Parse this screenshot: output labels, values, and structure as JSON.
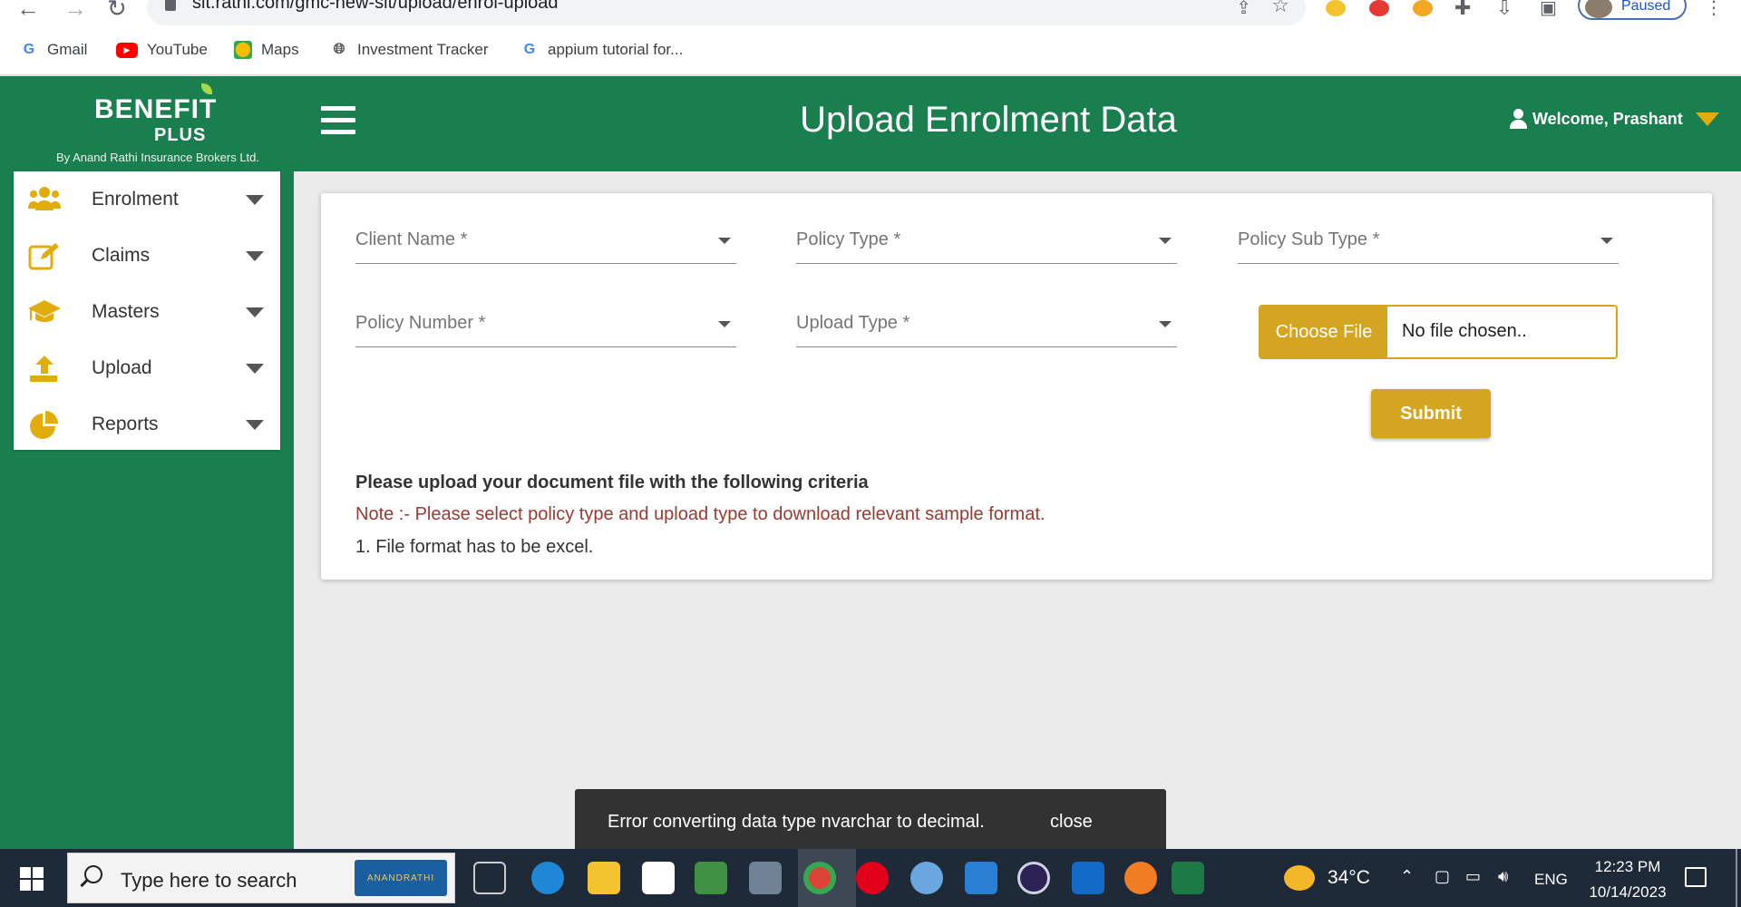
{
  "browser": {
    "url": "sit.rathi.com/gmc-new-sit/upload/enrol-upload",
    "profile_label": "Paused",
    "bookmarks": [
      {
        "label": "Gmail"
      },
      {
        "label": "YouTube"
      },
      {
        "label": "Maps"
      },
      {
        "label": "Investment Tracker"
      },
      {
        "label": "appium tutorial for..."
      }
    ]
  },
  "header": {
    "logo_main": "BENEFIT",
    "logo_sub": "PLUS",
    "logo_tagline": "By Anand Rathi Insurance Brokers Ltd.",
    "title": "Upload Enrolment Data",
    "welcome": "Welcome, Prashant"
  },
  "sidebar": {
    "items": [
      {
        "label": "Enrolment",
        "icon": "users-icon"
      },
      {
        "label": "Claims",
        "icon": "edit-icon"
      },
      {
        "label": "Masters",
        "icon": "graduation-cap-icon"
      },
      {
        "label": "Upload",
        "icon": "upload-icon"
      },
      {
        "label": "Reports",
        "icon": "pie-chart-icon"
      }
    ]
  },
  "form": {
    "client_name": "Client Name *",
    "policy_type": "Policy Type *",
    "policy_sub_type": "Policy Sub Type *",
    "policy_number": "Policy Number *",
    "upload_type": "Upload Type *",
    "choose_file": "Choose File",
    "file_status": "No file chosen..",
    "submit": "Submit"
  },
  "criteria": {
    "title": "Please upload your document file with the following criteria",
    "note": "Note :- Please select policy type and upload type to download relevant sample format.",
    "items": [
      "1. File format has to be excel."
    ]
  },
  "toast": {
    "message": "Error converting data type nvarchar to decimal.",
    "close": "close"
  },
  "taskbar": {
    "search_placeholder": "Type here to search",
    "search_logo": "ANANDRATHI",
    "weather": "34°C",
    "language": "ENG",
    "time": "12:23 PM",
    "date": "10/14/2023"
  },
  "colors": {
    "brand_green": "#1a7f4f",
    "accent_gold": "#d4a520",
    "note_red": "#9a3a30"
  }
}
